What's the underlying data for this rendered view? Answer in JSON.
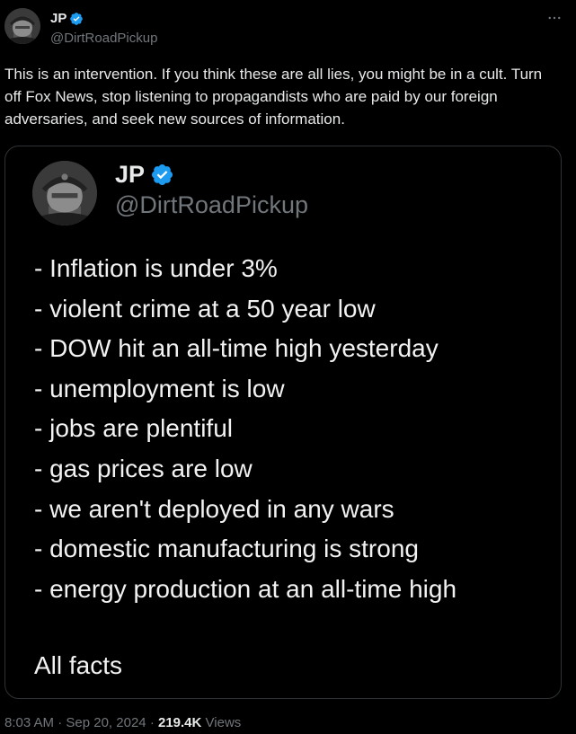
{
  "tweet": {
    "author": {
      "name": "JP",
      "handle": "@DirtRoadPickup",
      "verified": true
    },
    "text": "This is an intervention. If you think these are all lies, you might be in a cult. Turn off Fox News, stop listening to propagandists who are paid by our foreign adversaries, and seek new sources of information.",
    "more_icon": "ellipsis-icon"
  },
  "quoted_image": {
    "author": {
      "name": "JP",
      "handle": "@DirtRoadPickup",
      "verified": true
    },
    "items": [
      "- Inflation is under 3%",
      "- violent crime at a 50 year low",
      "- DOW hit an all-time high yesterday",
      "- unemployment is low",
      "- jobs are plentiful",
      "- gas prices are low",
      "- we aren't deployed in any wars",
      "- domestic manufacturing is strong",
      "- energy production at an all-time high"
    ],
    "footer": "All facts"
  },
  "meta": {
    "time": "8:03 AM",
    "separator": "·",
    "date": "Sep 20, 2024",
    "views_count": "219.4K",
    "views_label": "Views"
  },
  "colors": {
    "background": "#000000",
    "text": "#e7e9ea",
    "secondary": "#71767b",
    "verified": "#1d9bf0",
    "border": "#2f3336"
  }
}
